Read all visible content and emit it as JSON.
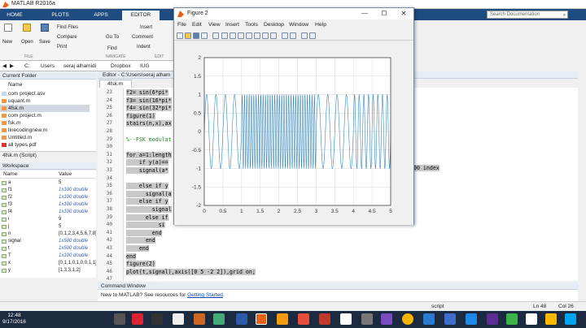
{
  "matlab": {
    "window_title": "MATLAB R2016a",
    "tabs": [
      "HOME",
      "PLOTS",
      "APPS",
      "EDITOR",
      "PUBLISH",
      "VIEW"
    ],
    "search_placeholder": "Search Documentation",
    "ribbon": {
      "new": "New",
      "open": "Open",
      "save": "Save",
      "find_files": "Find Files",
      "compare": "Compare",
      "print": "Print",
      "insert": "Insert",
      "go_to": "Go To",
      "comment": "Comment",
      "find": "Find",
      "indent": "Indent",
      "sections": [
        "FILE",
        "NAVIGATE",
        "EDIT"
      ]
    },
    "address": [
      "C:",
      "Users",
      "seraj alhamidi",
      "Dropbox",
      "IUG"
    ],
    "current_folder": {
      "title": "Current Folder",
      "column": "Name",
      "files": [
        "com project.asv",
        "uquant.m",
        "4fsk.m",
        "com project.m",
        "fsk.m",
        "linecodingnew.m",
        "Untitled.m",
        "all types.pdf"
      ],
      "selected_index": 2,
      "footer": "4fsk.m  (Script)"
    },
    "workspace": {
      "title": "Workspace",
      "columns": [
        "Name",
        "Value"
      ],
      "rows": [
        {
          "name": "a",
          "value": "5",
          "italic": false
        },
        {
          "name": "f1",
          "value": "1x100 double",
          "italic": true
        },
        {
          "name": "f2",
          "value": "1x100 double",
          "italic": true
        },
        {
          "name": "f3",
          "value": "1x100 double",
          "italic": true
        },
        {
          "name": "f4",
          "value": "1x100 double",
          "italic": true
        },
        {
          "name": "i",
          "value": "9",
          "italic": false
        },
        {
          "name": "j",
          "value": "5",
          "italic": false
        },
        {
          "name": "n",
          "value": "[0,1,2,3,4,5,6,7,8]",
          "italic": false
        },
        {
          "name": "signal",
          "value": "1x500 double",
          "italic": true
        },
        {
          "name": "t",
          "value": "1x500 double",
          "italic": true
        },
        {
          "name": "T",
          "value": "1x100 double",
          "italic": true
        },
        {
          "name": "x",
          "value": "[0,1,1,0,1,0,0,1,1]",
          "italic": false
        },
        {
          "name": "y",
          "value": "[1,3,3,1,2]",
          "italic": false
        }
      ]
    },
    "editor": {
      "header": "Editor - C:\\Users\\seraj alham",
      "tab": "4fsk.m",
      "lines": [
        {
          "n": "23",
          "text": "f2= sin(6*pi*",
          "sel": true
        },
        {
          "n": "24",
          "text": "f3= sin(16*pi*",
          "sel": true
        },
        {
          "n": "25",
          "text": "f4= sin(32*pi*",
          "sel": true
        },
        {
          "n": "26",
          "text": "figure(1)",
          "sel": true
        },
        {
          "n": "27",
          "text": "stairs(n,x),ax",
          "sel": true
        },
        {
          "n": "28",
          "text": "",
          "sel": false
        },
        {
          "n": "29",
          "text": "%--FSK modulat",
          "sel": false
        },
        {
          "n": "30",
          "text": "",
          "sel": false
        },
        {
          "n": "31",
          "text": "for a=1:length",
          "sel": true
        },
        {
          "n": "32",
          "text": "    if y(a)==",
          "sel": true
        },
        {
          "n": "33",
          "text": "    signal(a*",
          "sel": true
        },
        {
          "n": "34",
          "text": "",
          "sel": false
        },
        {
          "n": "35",
          "text": "    else if y",
          "sel": true
        },
        {
          "n": "36",
          "text": "      signal(a",
          "sel": true
        },
        {
          "n": "37",
          "text": "    else if y",
          "sel": true
        },
        {
          "n": "38",
          "text": "        signal",
          "sel": true
        },
        {
          "n": "39",
          "text": "      else if",
          "sel": true
        },
        {
          "n": "40",
          "text": "          si",
          "sel": true
        },
        {
          "n": "41",
          "text": "        end",
          "sel": true
        },
        {
          "n": "42",
          "text": "      end",
          "sel": true
        },
        {
          "n": "43",
          "text": "    end",
          "sel": true
        },
        {
          "n": "44",
          "text": "end",
          "sel": true
        },
        {
          "n": "45",
          "text": "figure(2)",
          "sel": true
        },
        {
          "n": "46",
          "text": "plot(t,signal),axis([0 5 -2 2]),grid on;",
          "sel": true
        },
        {
          "n": "47",
          "text": "",
          "sel": false
        }
      ],
      "right_fragment": "00 index"
    },
    "command_window": {
      "title": "Command Window",
      "text": "New to MATLAB? See resources for ",
      "link": "Getting Started",
      "period": "."
    },
    "status": {
      "mode": "script",
      "ln": "Ln  48",
      "col": "Col  26"
    },
    "clock": {
      "time": "12:48",
      "date": "9/17/2016"
    }
  },
  "figure": {
    "title": "Figure 2",
    "menu": [
      "File",
      "Edit",
      "View",
      "Insert",
      "Tools",
      "Desktop",
      "Window",
      "Help"
    ],
    "controls": {
      "minimize": "—",
      "maximize": "☐",
      "close": "✕"
    }
  },
  "chart_data": {
    "type": "line",
    "title": "",
    "xlabel": "",
    "ylabel": "",
    "xlim": [
      0,
      5
    ],
    "ylim": [
      -2,
      2
    ],
    "xticks": [
      "0",
      "0.5",
      "1",
      "1.5",
      "2",
      "2.5",
      "3",
      "3.5",
      "4",
      "4.5",
      "5"
    ],
    "yticks": [
      "2",
      "1.5",
      "1",
      "0.5",
      "0",
      "-0.5",
      "-1",
      "-1.5",
      "-2"
    ],
    "grid": true,
    "color": "#3a8ab8",
    "segments": [
      {
        "x_start": 0,
        "x_end": 1,
        "frequency_hz": 4
      },
      {
        "x_start": 1,
        "x_end": 2,
        "frequency_hz": 16
      },
      {
        "x_start": 2,
        "x_end": 3,
        "frequency_hz": 16
      },
      {
        "x_start": 3,
        "x_end": 4,
        "frequency_hz": 4
      },
      {
        "x_start": 4,
        "x_end": 5,
        "frequency_hz": 8
      }
    ],
    "amplitude": 1
  }
}
